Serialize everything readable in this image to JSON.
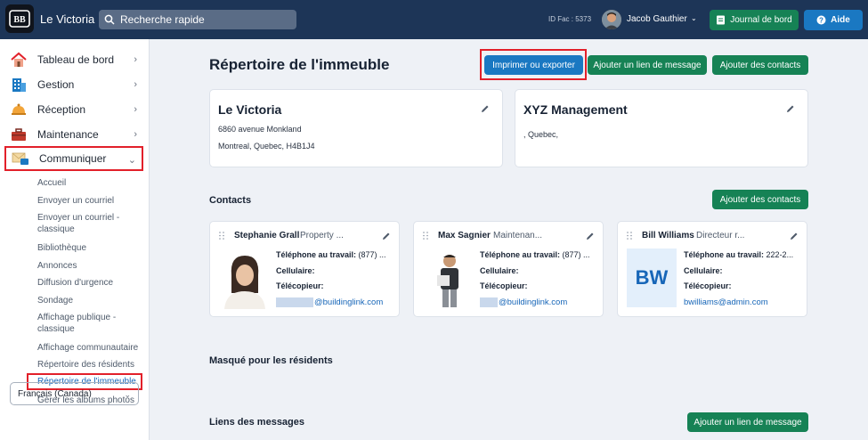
{
  "topbar": {
    "app_title": "Le Victoria",
    "search_placeholder": "Recherche rapide",
    "id_fac": "ID Fac : 5373",
    "user_name": "Jacob Gauthier",
    "journal_label": "Journal de bord",
    "help_label": "Aide"
  },
  "sidebar": {
    "items": [
      {
        "label": "Tableau de bord"
      },
      {
        "label": "Gestion"
      },
      {
        "label": "Réception"
      },
      {
        "label": "Maintenance"
      },
      {
        "label": "Communiquer"
      }
    ],
    "sub_items": [
      {
        "label": "Accueil"
      },
      {
        "label": "Envoyer un courriel"
      },
      {
        "label": "Envoyer un courriel - classique"
      },
      {
        "label": "Bibliothèque"
      },
      {
        "label": "Annonces"
      },
      {
        "label": "Diffusion d'urgence"
      },
      {
        "label": "Sondage"
      },
      {
        "label": "Affichage publique - classique"
      },
      {
        "label": "Affichage communautaire"
      },
      {
        "label": "Répertoire des résidents"
      },
      {
        "label": "Répertoire de l'immeuble"
      },
      {
        "label": "Gérer les albums photos"
      }
    ],
    "language": "Français (Canada)"
  },
  "main": {
    "title": "Répertoire de l'immeuble",
    "print_export_label": "Imprimer ou exporter",
    "add_message_link_label": "Ajouter un lien de message",
    "add_contacts_label": "Ajouter des contacts",
    "building": {
      "name": "Le Victoria",
      "address1": "6860 avenue Monkland",
      "address2": "Montreal, Quebec, H4B1J4"
    },
    "management": {
      "name": "XYZ Management",
      "address": ", Quebec,"
    },
    "contacts_section_title": "Contacts",
    "contacts_add_label": "Ajouter des contacts",
    "contacts": [
      {
        "name": "Stephanie Grall",
        "role": "Property ...",
        "work_phone_label": "Téléphone au travail:",
        "work_phone": "(877) ...",
        "cell_label": "Cellulaire:",
        "fax_label": "Télécopieur:",
        "email": "@buildinglink.com"
      },
      {
        "name": "Max Sagnier",
        "role": "Maintenan...",
        "work_phone_label": "Téléphone au travail:",
        "work_phone": "(877) ...",
        "cell_label": "Cellulaire:",
        "fax_label": "Télécopieur:",
        "email": "@buildinglink.com"
      },
      {
        "name": "Bill Williams",
        "role": "Directeur r...",
        "initials": "BW",
        "work_phone_label": "Téléphone au travail:",
        "work_phone": "222-2...",
        "cell_label": "Cellulaire:",
        "fax_label": "Télécopieur:",
        "email": "bwilliams@admin.com"
      }
    ],
    "hidden_section_title": "Masqué pour les résidents",
    "links_section_title": "Liens des messages",
    "links_add_label": "Ajouter un lien de message"
  }
}
